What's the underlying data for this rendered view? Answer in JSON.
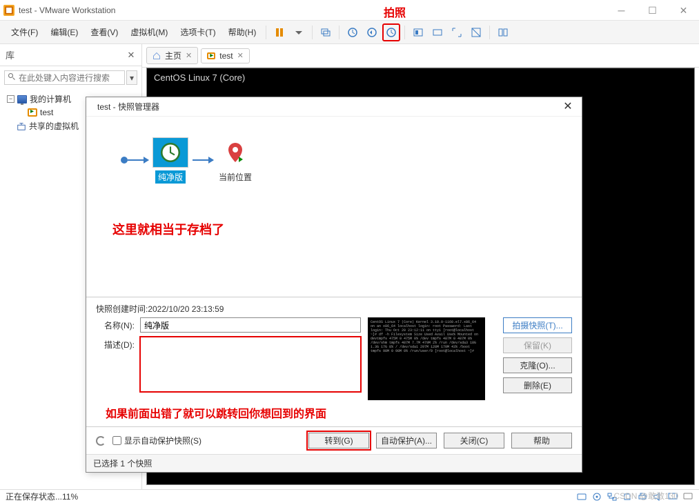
{
  "annotations": {
    "top": "拍照",
    "mid": "这里就相当于存档了",
    "bot": "如果前面出错了就可以跳转回你想回到的界面"
  },
  "title_bar": {
    "text": "test - VMware Workstation"
  },
  "menu": {
    "items": [
      "文件(F)",
      "编辑(E)",
      "查看(V)",
      "虚拟机(M)",
      "选项卡(T)",
      "帮助(H)"
    ]
  },
  "sidebar": {
    "title": "库",
    "search_placeholder": "在此处键入内容进行搜索",
    "tree": {
      "root": "我的计算机",
      "vm": "test",
      "shared": "共享的虚拟机"
    }
  },
  "tabs": {
    "home": "主页",
    "vm": "test"
  },
  "console": {
    "line1": "CentOS Linux 7 (Core)"
  },
  "dialog": {
    "title": "test - 快照管理器",
    "snapshot_name": "纯净版",
    "current_pos": "当前位置",
    "created_label": "快照创建时间:2022/10/20 23:13:59",
    "name_label": "名称(N):",
    "name_value": "纯净版",
    "desc_label": "描述(D):",
    "desc_value": "",
    "buttons": {
      "take": "拍摄快照(T)...",
      "keep": "保留(K)",
      "clone": "克隆(O)...",
      "delete": "删除(E)"
    },
    "footer": {
      "show_auto": "显示自动保护快照(S)",
      "goto": "转到(G)",
      "auto": "自动保护(A)...",
      "close": "关闭(C)",
      "help": "帮助"
    },
    "status": "已选择 1 个快照"
  },
  "status_bar": {
    "text": "正在保存状态...11%"
  },
  "watermark": "CSDN @敢敢130"
}
